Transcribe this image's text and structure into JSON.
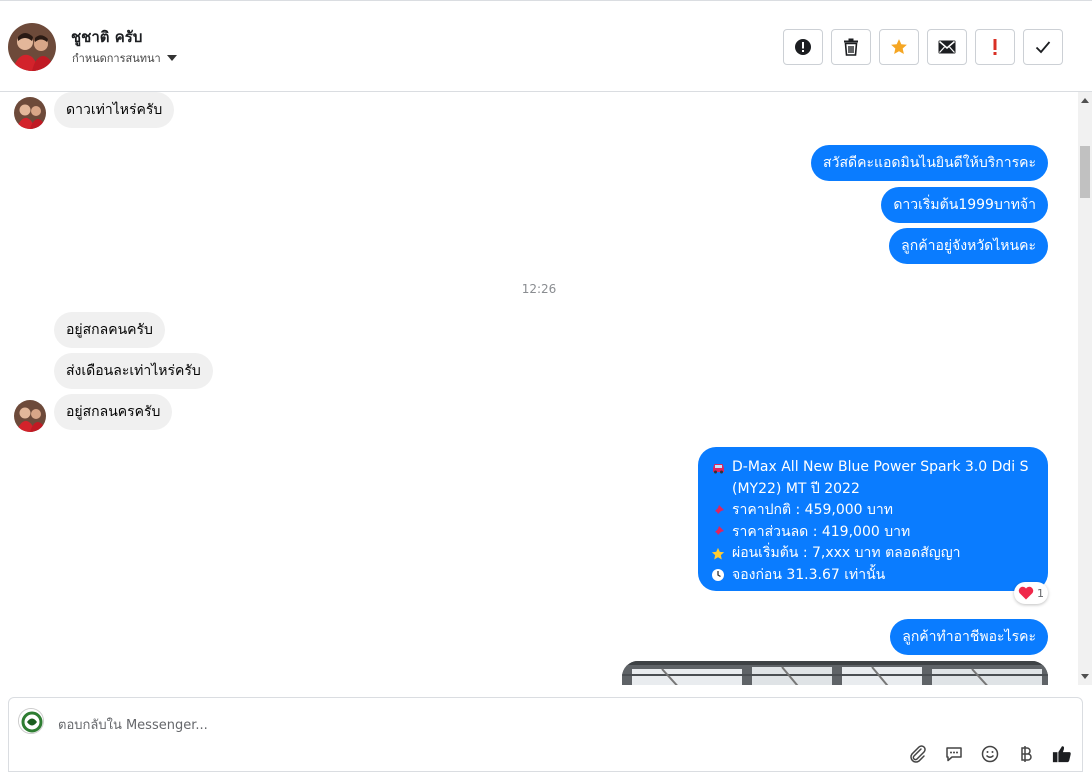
{
  "header": {
    "contact_name": "ชูชาติ ครับ",
    "assign_label": "กำหนดการสนทนา",
    "actions": [
      {
        "name": "report-icon"
      },
      {
        "name": "trash-icon"
      },
      {
        "name": "star-icon",
        "color": "#f5a623"
      },
      {
        "name": "mail-icon"
      },
      {
        "name": "mark-important-icon",
        "color": "#d93025"
      },
      {
        "name": "checkmark-icon"
      }
    ]
  },
  "thread": {
    "messages": [
      {
        "side": "in",
        "text": "ดาวเท่าไหร่ครับ"
      },
      {
        "side": "out",
        "text": "สวัสดีคะแอดมินไนยินดีให้บริการคะ"
      },
      {
        "side": "out",
        "text": "ดาวเริ่มต้น1999บาทจ้า"
      },
      {
        "side": "out",
        "text": "ลูกค้าอยู่จังหวัดไหนคะ"
      },
      {
        "side": "in",
        "text": "อยู่สกลคนครับ"
      },
      {
        "side": "in",
        "text": "ส่งเดือนละเท่าไหร่ครับ"
      },
      {
        "side": "in",
        "text": "อยู่สกลนครครับ"
      },
      {
        "side": "out",
        "text": "ลูกค้าทำอาชีพอะไรคะ"
      }
    ],
    "timestamp": "12:26",
    "card": {
      "lines": [
        {
          "icon": "car-icon",
          "text": "D-Max All New Blue Power Spark 3.0 Ddi S"
        },
        {
          "icon": "",
          "text": "(MY22) MT ปี 2022"
        },
        {
          "icon": "pushpin-icon",
          "text": "ราคาปกติ : 459,000 บาท"
        },
        {
          "icon": "pushpin-icon",
          "text": "ราคาส่วนลด : 419,000 บาท"
        },
        {
          "icon": "star-emoji-icon",
          "text": "ผ่อนเริ่มต้น : 7,xxx บาท ตลอดสัญญา"
        },
        {
          "icon": "clock-icon",
          "text": "จองก่อน 31.3.67 เท่านั้น"
        }
      ],
      "reaction": {
        "icon": "heart-icon",
        "count": "1"
      }
    }
  },
  "composer": {
    "placeholder": "ตอบกลับใน Messenger...",
    "tools": [
      "paperclip-icon",
      "saved-reply-icon",
      "emoji-icon",
      "baht-icon",
      "thumbs-up-icon"
    ]
  },
  "colors": {
    "outgoing_bubble": "#0a7cff",
    "incoming_bubble": "#f0f0f0"
  }
}
